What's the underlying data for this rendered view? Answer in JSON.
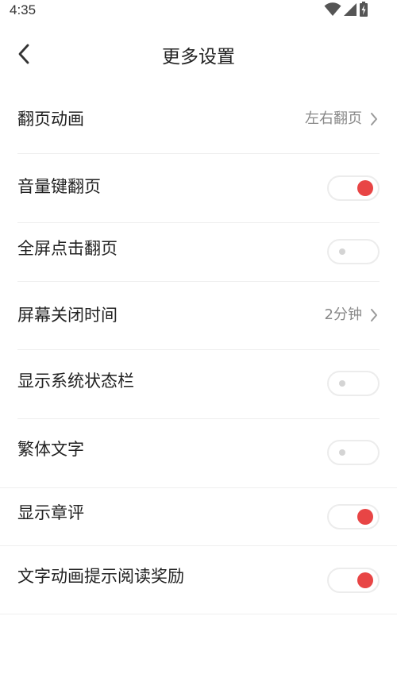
{
  "status_bar": {
    "time": "4:35",
    "icons": [
      "wifi-icon",
      "cellular-signal-icon",
      "battery-charging-icon"
    ]
  },
  "header": {
    "title": "更多设置",
    "back_icon": "chevron-left-icon"
  },
  "colors": {
    "accent": "#e84545",
    "toggle_off_knob": "#d4d4d4",
    "divider": "#eeeeee"
  },
  "settings": {
    "page_turn_animation": {
      "label": "翻页动画",
      "value": "左右翻页"
    },
    "volume_key_page_turn": {
      "label": "音量键翻页",
      "enabled": true
    },
    "fullscreen_tap_page_turn": {
      "label": "全屏点击翻页",
      "enabled": false
    },
    "screen_off_time": {
      "label": "屏幕关闭时间",
      "value": "2分钟"
    },
    "show_status_bar": {
      "label": "显示系统状态栏",
      "enabled": false
    },
    "traditional_chinese": {
      "label": "繁体文字",
      "enabled": false
    },
    "show_chapter_comments": {
      "label": "显示章评",
      "enabled": true
    },
    "reading_reward_animation": {
      "label": "文字动画提示阅读奖励",
      "enabled": true
    }
  }
}
